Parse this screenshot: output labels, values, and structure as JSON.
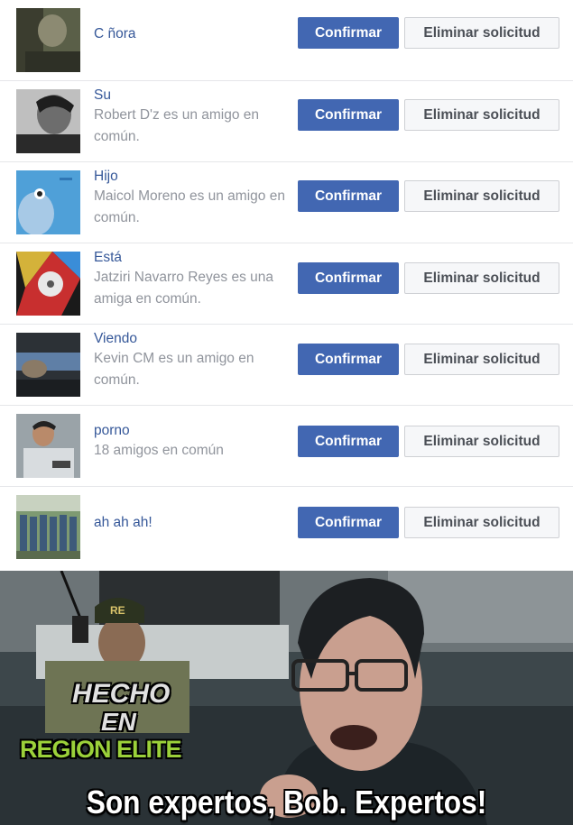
{
  "requests": [
    {
      "name": "C ñora",
      "mutual": "",
      "confirm_label": "Confirmar",
      "delete_label": "Eliminar solicitud"
    },
    {
      "name": "Su",
      "mutual": "Robert D'z es un amigo en común.",
      "confirm_label": "Confirmar",
      "delete_label": "Eliminar solicitud"
    },
    {
      "name": "Hijo",
      "mutual": "Maicol Moreno es un amigo en común.",
      "confirm_label": "Confirmar",
      "delete_label": "Eliminar solicitud"
    },
    {
      "name": "Está",
      "mutual": "Jatziri Navarro Reyes es una amiga en común.",
      "confirm_label": "Confirmar",
      "delete_label": "Eliminar solicitud"
    },
    {
      "name": "Viendo",
      "mutual": "Kevin CM es un amigo en común.",
      "confirm_label": "Confirmar",
      "delete_label": "Eliminar solicitud"
    },
    {
      "name": "porno",
      "mutual": "18 amigos en común",
      "confirm_label": "Confirmar",
      "delete_label": "Eliminar solicitud"
    },
    {
      "name": "ah ah ah!",
      "mutual": "",
      "confirm_label": "Confirmar",
      "delete_label": "Eliminar solicitud"
    }
  ],
  "meme": {
    "caption": "Son expertos, Bob. Expertos!",
    "watermark": {
      "line1": "HECHO",
      "line2": "EN",
      "line3": "REGION ELITE",
      "badge": "RE"
    }
  },
  "colors": {
    "confirm_bg": "#4267b2",
    "name_link": "#365899",
    "secondary_text": "#90949c"
  }
}
